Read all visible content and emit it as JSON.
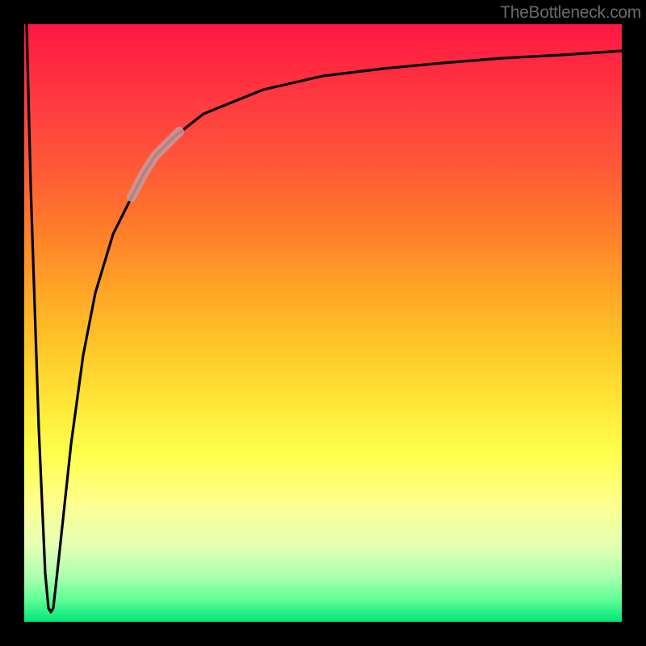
{
  "attribution": "TheBottleneck.com",
  "chart_data": {
    "type": "line",
    "title": "",
    "xlabel": "",
    "ylabel": "",
    "x_range": [
      0,
      100
    ],
    "y_range": [
      0,
      100
    ],
    "background_gradient": {
      "orientation": "vertical",
      "stops": [
        {
          "pos": 0.0,
          "color": "#ff1744"
        },
        {
          "pos": 0.5,
          "color": "#ffeb3b"
        },
        {
          "pos": 1.0,
          "color": "#00e676"
        }
      ]
    },
    "series": [
      {
        "name": "bottleneck-curve",
        "color": "#000000",
        "x": [
          0.5,
          1.5,
          3.0,
          4.0,
          4.5,
          5.0,
          6.0,
          8.0,
          10.0,
          12.0,
          15.0,
          18.0,
          20.0,
          22.0,
          25.0,
          30.0,
          35.0,
          40.0,
          50.0,
          60.0,
          70.0,
          80.0,
          90.0,
          100.0
        ],
        "y": [
          100,
          50,
          8,
          2,
          1,
          2,
          10,
          30,
          45,
          55,
          65,
          71,
          75,
          78,
          81,
          85,
          87,
          89,
          91,
          92.5,
          93.5,
          94.3,
          94.9,
          95.5
        ]
      },
      {
        "name": "highlight-segment",
        "color": "#d9a6a6",
        "stroke_width": 10,
        "x": [
          18.0,
          20.0,
          22.0,
          24.0,
          26.0
        ],
        "y": [
          71.0,
          75.0,
          78.0,
          80.0,
          82.0
        ]
      }
    ],
    "notch": {
      "x": 4.2,
      "y_curve": 1
    }
  }
}
